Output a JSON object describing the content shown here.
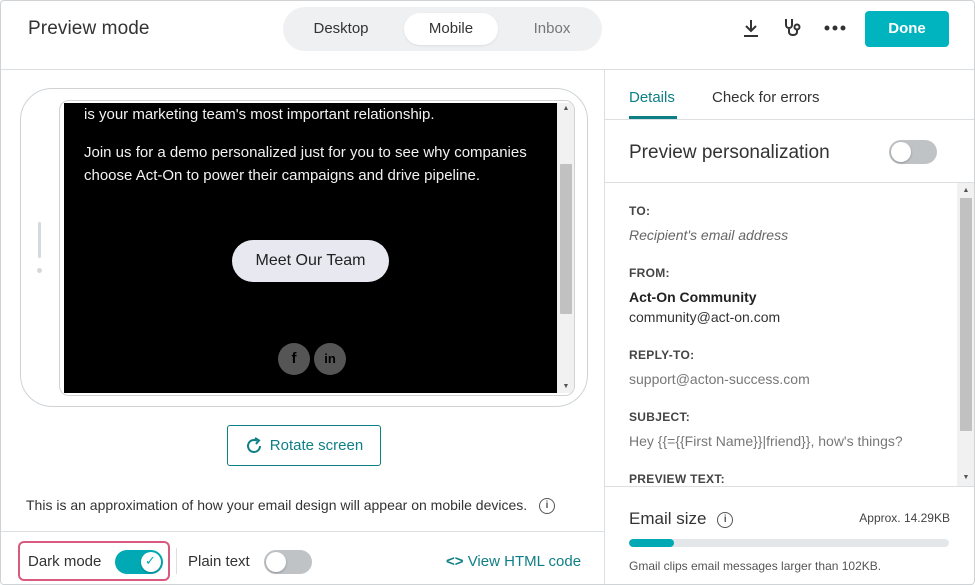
{
  "header": {
    "title": "Preview mode",
    "tabs": [
      {
        "label": "Desktop",
        "active": false
      },
      {
        "label": "Mobile",
        "active": true
      },
      {
        "label": "Inbox",
        "active": false
      }
    ],
    "icons": [
      "download-icon",
      "stethoscope-icon",
      "more-icon"
    ],
    "done_label": "Done"
  },
  "email": {
    "line1": "is your marketing team's most important relationship.",
    "paragraph": "Join us for a demo personalized just for you to see why companies choose Act-On to power their campaigns and drive pipeline.",
    "button_label": "Meet Our Team",
    "social": [
      {
        "icon": "facebook-icon",
        "glyph": "f"
      },
      {
        "icon": "linkedin-icon",
        "glyph": "in"
      }
    ]
  },
  "preview": {
    "rotate_label": "Rotate screen",
    "approx_note": "This is an approximation of how your email design will appear on mobile devices.",
    "dark_mode_label": "Dark mode",
    "dark_mode_on": true,
    "plain_text_label": "Plain text",
    "plain_text_on": false,
    "view_html_label": "View HTML code"
  },
  "right": {
    "tabs": [
      {
        "label": "Details",
        "active": true
      },
      {
        "label": "Check for errors",
        "active": false
      }
    ],
    "personalization_label": "Preview personalization",
    "personalization_on": false,
    "details": {
      "to_label": "TO:",
      "to_value": "Recipient's email address",
      "from_label": "FROM:",
      "from_name": "Act-On Community",
      "from_email": "community@act-on.com",
      "reply_label": "REPLY-TO:",
      "reply_value": "support@acton-success.com",
      "subject_label": "SUBJECT:",
      "subject_value": "Hey {{={{First Name}}|friend}}, how's things?",
      "preview_label": "PREVIEW TEXT:"
    },
    "size": {
      "label": "Email size",
      "approx": "Approx. 14.29KB",
      "fill_fraction": 0.14,
      "note": "Gmail clips email messages larger than 102KB."
    }
  },
  "colors": {
    "accent": "#00b4bf",
    "link": "#0f7f86",
    "highlight": "#d85a7f"
  }
}
